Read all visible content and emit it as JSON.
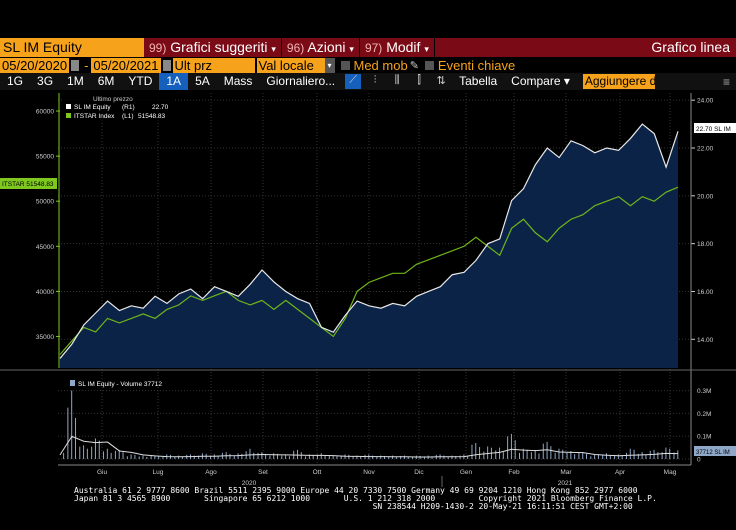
{
  "header": {
    "ticker": "SL IM Equity",
    "menus": [
      {
        "num": "99)",
        "label": "Grafici suggeriti"
      },
      {
        "num": "96)",
        "label": "Azioni"
      },
      {
        "num": "97)",
        "label": "Modif"
      }
    ],
    "title": "Grafico linea"
  },
  "controls": {
    "start_date": "05/20/2020",
    "sep": "-",
    "end_date": "05/20/2021",
    "field": "Ult prz",
    "currency": "Val locale",
    "moving_avg": "Med mob",
    "key_events": "Eventi chiave"
  },
  "periods": [
    "1G",
    "3G",
    "1M",
    "6M",
    "YTD",
    "1A",
    "5A",
    "Mass"
  ],
  "active_period": "1A",
  "frequency": "Giornaliero...",
  "table_label": "Tabella",
  "compare_label": "Compare",
  "add_placeholder": "Aggiungere d",
  "legend": {
    "title": "Ultimo prezzo",
    "items": [
      {
        "name": "SL IM Equity",
        "axis": "(R1)",
        "value": "22.70",
        "color": "#ffffff"
      },
      {
        "name": "ITSTAR Index",
        "axis": "(L1)",
        "value": "51548.83",
        "color": "#7ec820"
      }
    ]
  },
  "tags": {
    "left": "ITSTAR 51548.83",
    "right": "22.70 SL IM",
    "volume": "37712 SL IM"
  },
  "volume_legend": "SL IM Equity - Volume 37712",
  "footer": [
    "Australia 61 2 9777 8600 Brazil 5511 2395 9000 Europe 44 20 7330 7500 Germany 49 69 9204 1210 Hong Kong 852 2977 6000",
    "Japan 81 3 4565 8900       Singapore 65 6212 1000       U.S. 1 212 318 2000         Copyright 2021 Bloomberg Finance L.P.",
    "                                                              SN 238544 H209-1430-2 20-May-21 16:11:51 CEST GMT+2:00"
  ],
  "chart_data": {
    "type": "line",
    "left_axis": {
      "ticks": [
        "35000",
        "40000",
        "45000",
        "50000",
        "55000",
        "60000"
      ],
      "range": [
        31500,
        62000
      ]
    },
    "right_axis": {
      "ticks": [
        "14.00",
        "16.00",
        "18.00",
        "20.00",
        "22.00",
        "24.00"
      ],
      "range": [
        12.8,
        24.3
      ]
    },
    "volume_axis": {
      "ticks": [
        "0",
        "0.1M",
        "0.2M",
        "0.3M"
      ],
      "range": [
        0,
        320
      ]
    },
    "months": [
      "Giu",
      "Lug",
      "Ago",
      "Set",
      "Ott",
      "Nov",
      "Dic",
      "Gen",
      "Feb",
      "Mar",
      "Apr",
      "Mag"
    ],
    "years": [
      "2020",
      "2021"
    ],
    "series": [
      {
        "name": "SL IM Equity",
        "color": "#e8e8e8",
        "values": [
          13.2,
          13.8,
          14.6,
          15.1,
          15.6,
          15.2,
          15.4,
          15.3,
          15.8,
          15.5,
          15.9,
          16.1,
          15.7,
          16.2,
          16.0,
          15.8,
          16.3,
          16.9,
          16.4,
          16.0,
          15.7,
          15.5,
          14.5,
          14.3,
          15.0,
          15.6,
          15.4,
          15.3,
          15.5,
          15.4,
          15.8,
          16.0,
          16.2,
          16.7,
          16.8,
          17.3,
          18.0,
          18.2,
          19.8,
          20.3,
          21.3,
          22.0,
          21.6,
          22.3,
          22.1,
          21.8,
          22.0,
          21.9,
          22.4,
          23.0,
          22.6,
          21.2,
          22.7
        ]
      },
      {
        "name": "ITSTAR Index",
        "color": "#6fb51a",
        "values": [
          33000,
          34500,
          36000,
          35500,
          37000,
          36500,
          37000,
          37500,
          37000,
          38000,
          38500,
          39500,
          39000,
          39500,
          40000,
          39000,
          38500,
          39000,
          38000,
          39000,
          38000,
          37000,
          36000,
          35000,
          37000,
          40000,
          41000,
          41500,
          42000,
          42000,
          43000,
          43500,
          44000,
          44500,
          45000,
          46000,
          45000,
          44000,
          47000,
          48000,
          46500,
          45500,
          47000,
          48000,
          48500,
          49500,
          50000,
          50500,
          49500,
          50500,
          50000,
          51000,
          51548.83
        ]
      },
      {
        "name": "Volume (K)",
        "color": "#8fa8c8",
        "values": [
          30,
          300,
          60,
          90,
          45,
          40,
          20,
          15,
          15,
          20,
          15,
          20,
          25,
          20,
          30,
          25,
          45,
          30,
          25,
          20,
          40,
          20,
          25,
          15,
          20,
          15,
          20,
          15,
          15,
          15,
          15,
          15,
          20,
          15,
          20,
          70,
          55,
          50,
          110,
          45,
          40,
          75,
          45,
          35,
          30,
          20,
          25,
          20,
          45,
          30,
          40,
          50,
          38
        ]
      }
    ]
  }
}
